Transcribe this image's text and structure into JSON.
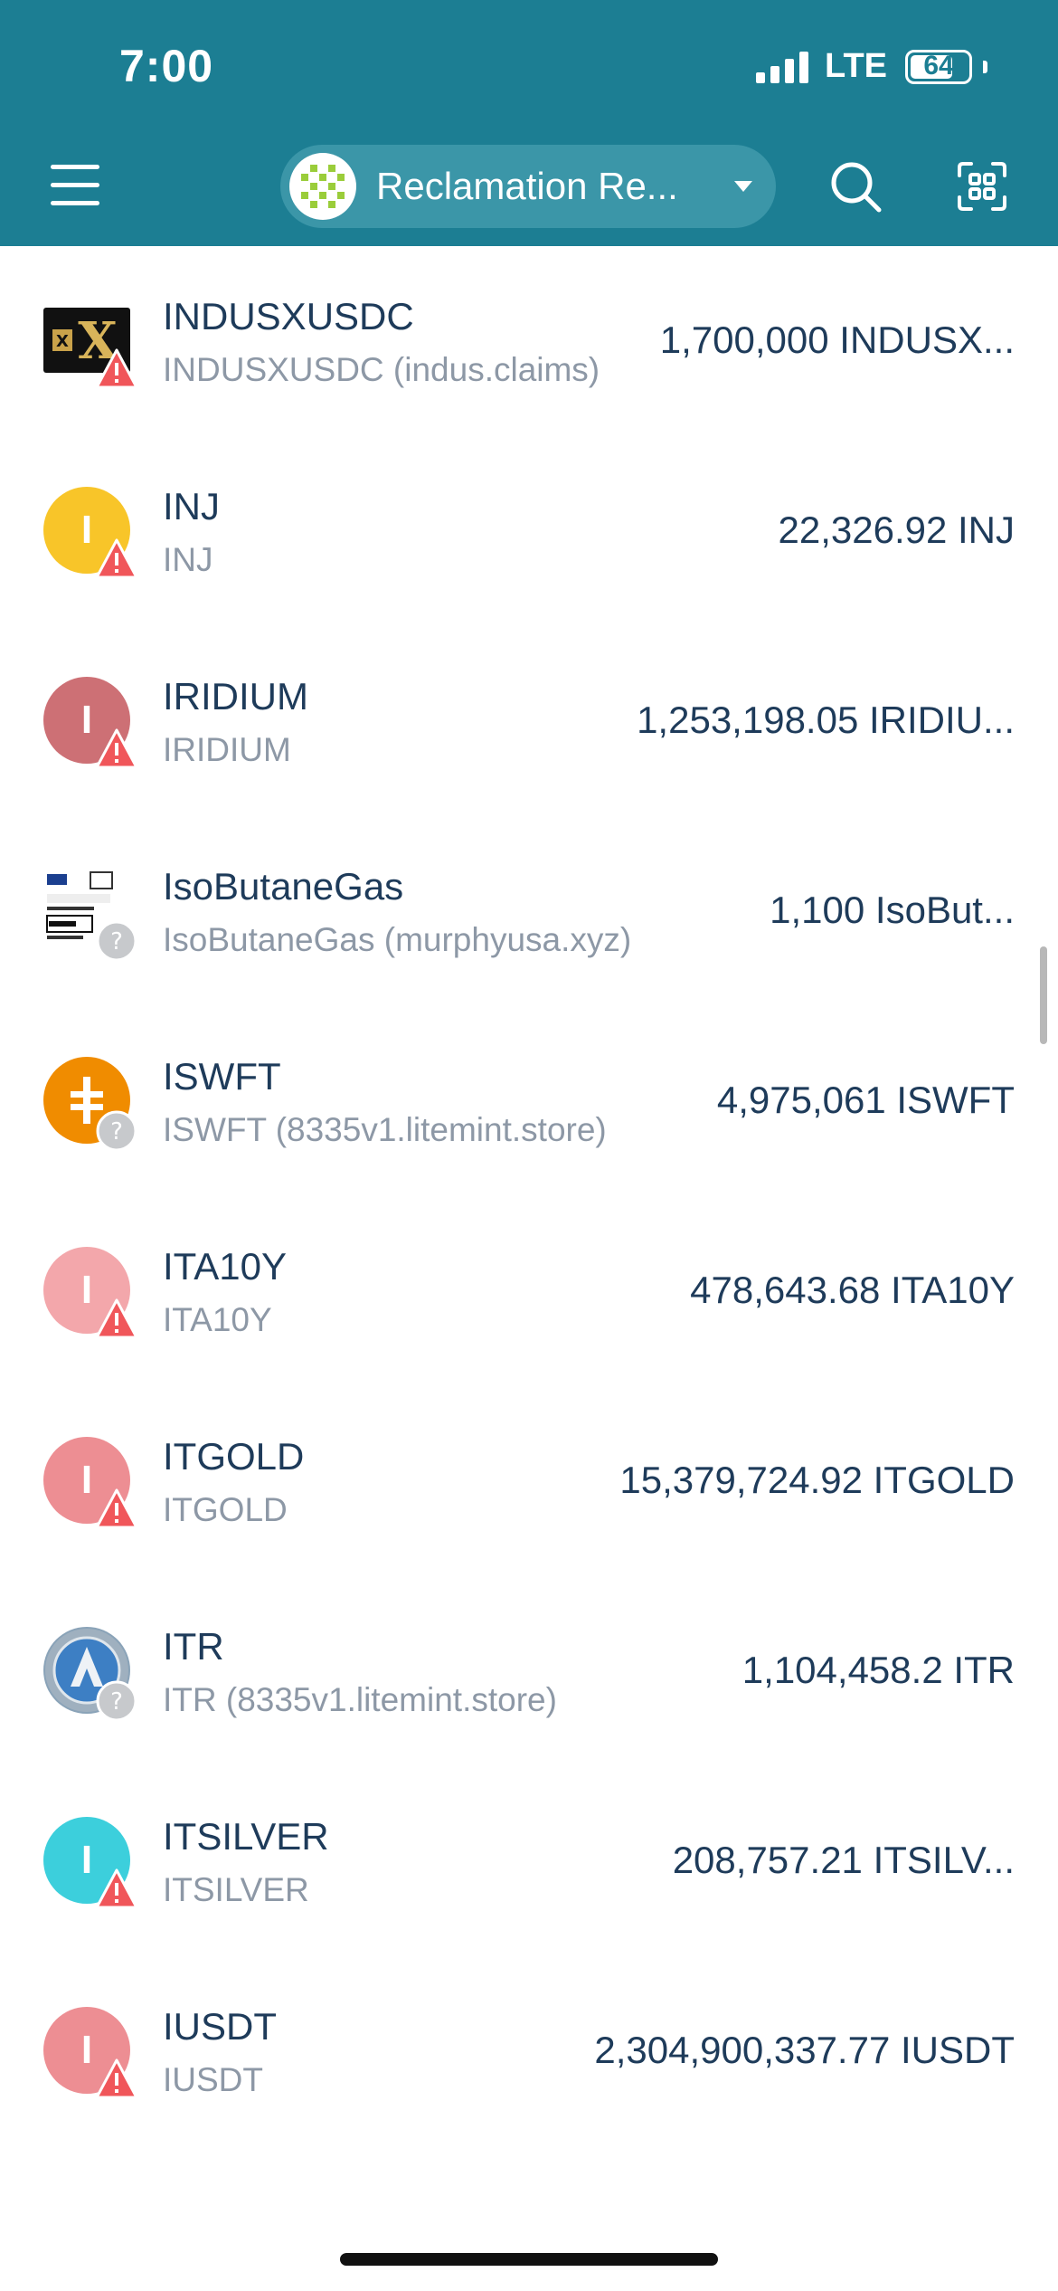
{
  "status_bar": {
    "time": "7:00",
    "network": "LTE",
    "battery": "64"
  },
  "header": {
    "account_name": "Reclamation Re...",
    "icons": [
      "menu-icon",
      "search-icon",
      "qr-scan-icon"
    ]
  },
  "tokens": [
    {
      "symbol": "INDUSXUSDC",
      "subtitle": "INDUSXUSDC (indus.claims)",
      "balance": "1,700,000 INDUSX...",
      "icon": "indusx-logo",
      "badge": "warning-icon"
    },
    {
      "symbol": "INJ",
      "subtitle": "INJ",
      "balance": "22,326.92 INJ",
      "icon_letter": "I",
      "icon_color": "#f8c529",
      "badge": "warning-icon"
    },
    {
      "symbol": "IRIDIUM",
      "subtitle": "IRIDIUM",
      "balance": "1,253,198.05 IRIDIU...",
      "icon_letter": "I",
      "icon_color": "#cd7075",
      "badge": "warning-icon"
    },
    {
      "symbol": "IsoButaneGas",
      "subtitle": "IsoButaneGas (murphyusa.xyz)",
      "balance": "1,100 IsoBut...",
      "icon": "isobutane-label-image",
      "badge": "question-icon"
    },
    {
      "symbol": "ISWFT",
      "subtitle": "ISWFT (8335v1.litemint.store)",
      "balance": "4,975,061 ISWFT",
      "icon": "iswft-coin",
      "icon_color": "#f08c00",
      "badge": "question-icon"
    },
    {
      "symbol": "ITA10Y",
      "subtitle": "ITA10Y",
      "balance": "478,643.68 ITA10Y",
      "icon_letter": "I",
      "icon_color": "#f3a7ab",
      "badge": "warning-icon"
    },
    {
      "symbol": "ITGOLD",
      "subtitle": "ITGOLD",
      "balance": "15,379,724.92 ITGOLD",
      "icon_letter": "I",
      "icon_color": "#ed8e93",
      "badge": "warning-icon"
    },
    {
      "symbol": "ITR",
      "subtitle": "ITR (8335v1.litemint.store)",
      "balance": "1,104,458.2 ITR",
      "icon": "itr-globe-logo",
      "badge": "question-icon"
    },
    {
      "symbol": "ITSILVER",
      "subtitle": "ITSILVER",
      "balance": "208,757.21 ITSILV...",
      "icon_letter": "I",
      "icon_color": "#3ccfdc",
      "badge": "warning-icon"
    },
    {
      "symbol": "IUSDT",
      "subtitle": "IUSDT",
      "balance": "2,304,900,337.77 IUSDT",
      "icon_letter": "I",
      "icon_color": "#ed8e93",
      "badge": "warning-icon"
    }
  ],
  "colors": {
    "header_bg": "#1c7e93",
    "pill_bg": "#3b96a8",
    "text_primary": "#1e3b5a",
    "text_secondary": "#8d98a6",
    "warning": "#f0565a"
  }
}
